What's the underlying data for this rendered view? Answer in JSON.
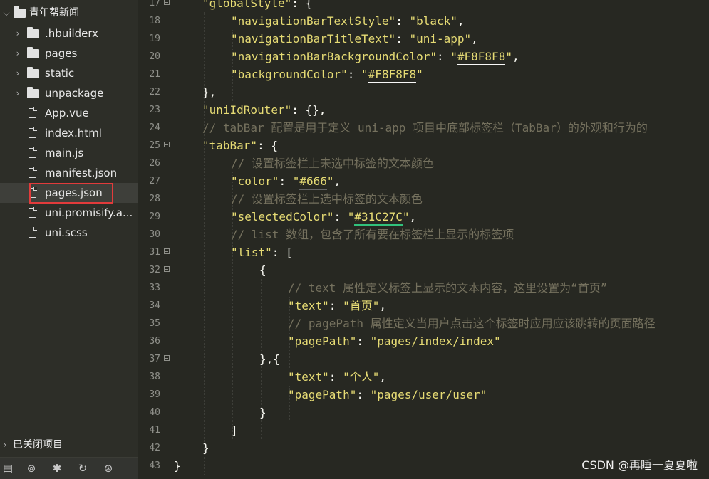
{
  "sidebar": {
    "project": {
      "label": "青年帮新闻",
      "arrow": "expanded"
    },
    "items": [
      {
        "label": ".hbuilderx",
        "type": "folder",
        "icon": "folder-icon"
      },
      {
        "label": "pages",
        "type": "folder",
        "icon": "folder-icon"
      },
      {
        "label": "static",
        "type": "folder",
        "icon": "folder-icon"
      },
      {
        "label": "unpackage",
        "type": "folder",
        "icon": "folder-icon"
      },
      {
        "label": "App.vue",
        "type": "file",
        "icon": "file-icon"
      },
      {
        "label": "index.html",
        "type": "file",
        "icon": "file-icon"
      },
      {
        "label": "main.js",
        "type": "file",
        "icon": "file-icon"
      },
      {
        "label": "manifest.json",
        "type": "file",
        "icon": "file-icon"
      },
      {
        "label": "pages.json",
        "type": "file",
        "icon": "file-icon",
        "selected": true
      },
      {
        "label": "uni.promisify.a...",
        "type": "file",
        "icon": "file-icon"
      },
      {
        "label": "uni.scss",
        "type": "file",
        "icon": "file-icon"
      }
    ],
    "closed_projects": "已关闭项目",
    "toolbar_icons": [
      "list-icon",
      "binoculars-icon",
      "bug-icon",
      "git-refresh-icon",
      "network-icon"
    ]
  },
  "editor": {
    "lines": [
      {
        "n": "17",
        "fold": true,
        "indent": 1,
        "parts": [
          [
            "s",
            "\"globalStyle\""
          ],
          [
            "p",
            ": {"
          ]
        ]
      },
      {
        "n": "18",
        "fold": false,
        "indent": 2,
        "parts": [
          [
            "s",
            "\"navigationBarTextStyle\""
          ],
          [
            "p",
            ": "
          ],
          [
            "s",
            "\"black\""
          ],
          [
            "p",
            ","
          ]
        ]
      },
      {
        "n": "19",
        "fold": false,
        "indent": 2,
        "parts": [
          [
            "s",
            "\"navigationBarTitleText\""
          ],
          [
            "p",
            ": "
          ],
          [
            "s",
            "\"uni-app\""
          ],
          [
            "p",
            ","
          ]
        ]
      },
      {
        "n": "20",
        "fold": false,
        "indent": 2,
        "parts": [
          [
            "s",
            "\"navigationBarBackgroundColor\""
          ],
          [
            "p",
            ": "
          ],
          [
            "s",
            "\""
          ],
          [
            "u#F8F8F8",
            "#F8F8F8"
          ],
          [
            "s",
            "\""
          ],
          [
            "p",
            ","
          ]
        ]
      },
      {
        "n": "21",
        "fold": false,
        "indent": 2,
        "parts": [
          [
            "s",
            "\"backgroundColor\""
          ],
          [
            "p",
            ": "
          ],
          [
            "s",
            "\""
          ],
          [
            "u#F8F8F8",
            "#F8F8F8"
          ],
          [
            "s",
            "\""
          ]
        ]
      },
      {
        "n": "22",
        "fold": false,
        "indent": 1,
        "parts": [
          [
            "p",
            "},"
          ]
        ]
      },
      {
        "n": "23",
        "fold": false,
        "indent": 1,
        "parts": [
          [
            "s",
            "\"uniIdRouter\""
          ],
          [
            "p",
            ": {},"
          ]
        ]
      },
      {
        "n": "24",
        "fold": false,
        "indent": 1,
        "parts": [
          [
            "c",
            "// tabBar 配置是用于定义 uni-app 项目中底部标签栏（TabBar）的外观和行为的"
          ]
        ]
      },
      {
        "n": "25",
        "fold": true,
        "indent": 1,
        "parts": [
          [
            "s",
            "\"tabBar\""
          ],
          [
            "p",
            ": {"
          ]
        ]
      },
      {
        "n": "26",
        "fold": false,
        "indent": 2,
        "parts": [
          [
            "c",
            "// 设置标签栏上未选中标签的文本颜色"
          ]
        ]
      },
      {
        "n": "27",
        "fold": false,
        "indent": 2,
        "parts": [
          [
            "s",
            "\"color\""
          ],
          [
            "p",
            ": "
          ],
          [
            "s",
            "\""
          ],
          [
            "u#666666",
            "#666"
          ],
          [
            "s",
            "\""
          ],
          [
            "p",
            ","
          ]
        ]
      },
      {
        "n": "28",
        "fold": false,
        "indent": 2,
        "parts": [
          [
            "c",
            "// 设置标签栏上选中标签的文本颜色"
          ]
        ]
      },
      {
        "n": "29",
        "fold": false,
        "indent": 2,
        "parts": [
          [
            "s",
            "\"selectedColor\""
          ],
          [
            "p",
            ": "
          ],
          [
            "s",
            "\""
          ],
          [
            "u#31C27C",
            "#31C27C"
          ],
          [
            "s",
            "\""
          ],
          [
            "p",
            ","
          ]
        ]
      },
      {
        "n": "30",
        "fold": false,
        "indent": 2,
        "parts": [
          [
            "c",
            "// list 数组，包含了所有要在标签栏上显示的标签项"
          ]
        ]
      },
      {
        "n": "31",
        "fold": true,
        "indent": 2,
        "parts": [
          [
            "s",
            "\"list\""
          ],
          [
            "p",
            ": ["
          ]
        ]
      },
      {
        "n": "32",
        "fold": true,
        "indent": 3,
        "parts": [
          [
            "p",
            "{"
          ]
        ]
      },
      {
        "n": "33",
        "fold": false,
        "indent": 4,
        "parts": [
          [
            "c",
            "// text 属性定义标签上显示的文本内容，这里设置为“首页”"
          ]
        ]
      },
      {
        "n": "34",
        "fold": false,
        "indent": 4,
        "parts": [
          [
            "s",
            "\"text\""
          ],
          [
            "p",
            ": "
          ],
          [
            "s",
            "\"首页\""
          ],
          [
            "p",
            ","
          ]
        ]
      },
      {
        "n": "35",
        "fold": false,
        "indent": 4,
        "parts": [
          [
            "c",
            "// pagePath 属性定义当用户点击这个标签时应用应该跳转的页面路径"
          ]
        ]
      },
      {
        "n": "36",
        "fold": false,
        "indent": 4,
        "parts": [
          [
            "s",
            "\"pagePath\""
          ],
          [
            "p",
            ": "
          ],
          [
            "s",
            "\"pages/index/index\""
          ]
        ]
      },
      {
        "n": "37",
        "fold": true,
        "indent": 3,
        "parts": [
          [
            "p",
            "},{"
          ]
        ]
      },
      {
        "n": "38",
        "fold": false,
        "indent": 4,
        "parts": [
          [
            "s",
            "\"text\""
          ],
          [
            "p",
            ": "
          ],
          [
            "s",
            "\"个人\""
          ],
          [
            "p",
            ","
          ]
        ]
      },
      {
        "n": "39",
        "fold": false,
        "indent": 4,
        "parts": [
          [
            "s",
            "\"pagePath\""
          ],
          [
            "p",
            ": "
          ],
          [
            "s",
            "\"pages/user/user\""
          ]
        ]
      },
      {
        "n": "40",
        "fold": false,
        "indent": 3,
        "parts": [
          [
            "p",
            "}"
          ]
        ]
      },
      {
        "n": "41",
        "fold": false,
        "indent": 2,
        "parts": [
          [
            "p",
            "]"
          ]
        ]
      },
      {
        "n": "42",
        "fold": false,
        "indent": 1,
        "parts": [
          [
            "p",
            "}"
          ]
        ]
      },
      {
        "n": "43",
        "fold": false,
        "indent": 0,
        "parts": [
          [
            "p",
            "}"
          ]
        ]
      }
    ]
  },
  "watermark": "CSDN @再睡一夏夏啦",
  "colors": {
    "editor_bg": "#272822",
    "sidebar_bg": "#2d2e28",
    "key_string": "#e6db74",
    "comment": "#75715e",
    "highlight_border": "#e23b3b"
  }
}
